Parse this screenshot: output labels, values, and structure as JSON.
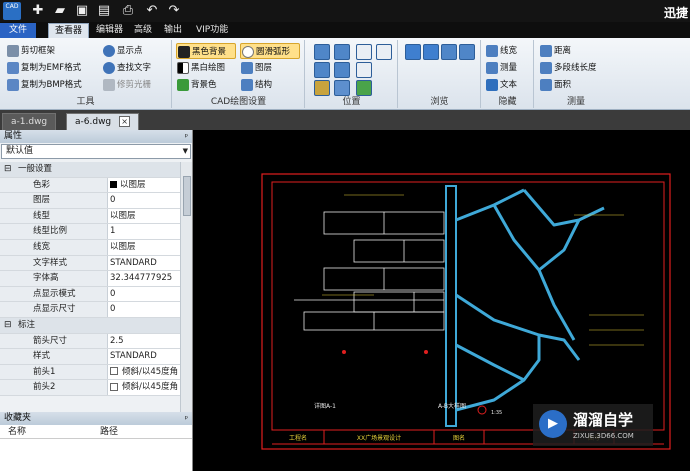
{
  "app": {
    "logo_text": "CAD",
    "title": "迅捷"
  },
  "quick_access": [
    "new-icon",
    "open-icon",
    "save-icon",
    "save-as-icon",
    "print-icon",
    "undo-icon",
    "redo-icon"
  ],
  "menu": {
    "tabs": [
      "文件",
      "查看器",
      "编辑器",
      "高级",
      "输出",
      "VIP功能"
    ],
    "active": "查看器"
  },
  "ribbon": {
    "tools": {
      "label": "工具",
      "items": [
        "剪切框架",
        "复制为EMF格式",
        "复制为BMP格式",
        "显示点",
        "查找文字",
        "修剪光栅"
      ]
    },
    "cad_settings": {
      "label": "CAD绘图设置",
      "items": [
        "黑色背景",
        "黑白绘图",
        "背景色",
        "圆滑弧形",
        "图层",
        "结构"
      ]
    },
    "position": {
      "label": "位置"
    },
    "browse": {
      "label": "浏览"
    },
    "hide": {
      "label": "隐藏",
      "items": [
        "线宽",
        "测量",
        "文本"
      ]
    },
    "measure": {
      "label": "测量",
      "items": [
        "距离",
        "多段线长度",
        "面积"
      ]
    }
  },
  "doc_tabs": {
    "tabs": [
      "a-1.dwg",
      "a-6.dwg"
    ],
    "active": "a-6.dwg",
    "close_glyph": "×"
  },
  "properties": {
    "title": "属性",
    "pin": "ᵖ",
    "selector": "默认值",
    "rows": [
      {
        "type": "cat",
        "key": "一般设置"
      },
      {
        "key": "色彩",
        "value": "以图层",
        "swatch": true
      },
      {
        "key": "图层",
        "value": "0"
      },
      {
        "key": "线型",
        "value": "以图层"
      },
      {
        "key": "线型比例",
        "value": "1"
      },
      {
        "key": "线宽",
        "value": "以图层"
      },
      {
        "key": "文字样式",
        "value": "STANDARD"
      },
      {
        "key": "字体高",
        "value": "32.344777925"
      },
      {
        "key": "点显示模式",
        "value": "0"
      },
      {
        "key": "点显示尺寸",
        "value": "0"
      },
      {
        "type": "cat",
        "key": "标注"
      },
      {
        "key": "箭头尺寸",
        "value": "2.5"
      },
      {
        "key": "样式",
        "value": "STANDARD"
      },
      {
        "key": "前头1",
        "value": "倾斜/以45度角",
        "check": true
      },
      {
        "key": "前头2",
        "value": "倾斜/以45度角",
        "check": true
      }
    ]
  },
  "favorites": {
    "title": "收藏夹",
    "pin": "ᵖ",
    "columns": [
      "名称",
      "路径"
    ]
  },
  "drawing": {
    "frame_color": "#e01f1f",
    "stone_color": "#3fa9d8",
    "title_cells": [
      "工程名",
      "XX广场景观设计",
      "图名",
      "图号"
    ],
    "labels": [
      "详图A-1",
      "A-B大样图",
      "1:35"
    ]
  },
  "watermark": {
    "logo_glyph": "▶",
    "name": "溜溜自学",
    "url": "ZIXUE.3D66.COM"
  },
  "colors": {
    "accent": "#2a63c4",
    "ribbon_bg": "#e6ecf2",
    "highlight": "#ffe08a"
  }
}
